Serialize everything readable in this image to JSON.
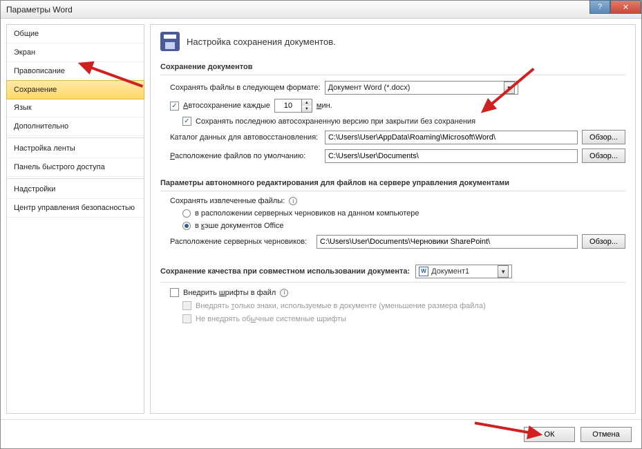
{
  "window": {
    "title": "Параметры Word"
  },
  "sidebar": {
    "items": [
      {
        "label": "Общие"
      },
      {
        "label": "Экран"
      },
      {
        "label": "Правописание"
      },
      {
        "label": "Сохранение",
        "selected": true
      },
      {
        "label": "Язык"
      },
      {
        "label": "Дополнительно"
      },
      {
        "label": "Настройка ленты"
      },
      {
        "label": "Панель быстрого доступа"
      },
      {
        "label": "Надстройки"
      },
      {
        "label": "Центр управления безопасностью"
      }
    ]
  },
  "header": {
    "title": "Настройка сохранения документов."
  },
  "section1": {
    "title": "Сохранение документов",
    "save_format_label": "Сохранять файлы в следующем формате:",
    "save_format_value": "Документ Word (*.docx)",
    "autosave_label_pre": "Автосохранение каждые",
    "autosave_value": "10",
    "autosave_label_post": "мин.",
    "keep_last_label": "Сохранять последнюю автосохраненную версию при закрытии без сохранения",
    "autorecover_label": "Каталог данных для автовосстановления:",
    "autorecover_path": "C:\\Users\\User\\AppData\\Roaming\\Microsoft\\Word\\",
    "default_loc_label": "Расположение файлов по умолчанию:",
    "default_loc_path": "C:\\Users\\User\\Documents\\",
    "browse": "Обзор..."
  },
  "section2": {
    "title": "Параметры автономного редактирования для файлов на сервере управления документами",
    "save_checked_label": "Сохранять извлеченные файлы:",
    "radio1": "в расположении серверных черновиков на данном компьютере",
    "radio2": "в кэше документов Office",
    "drafts_label": "Расположение серверных черновиков:",
    "drafts_path": "C:\\Users\\User\\Documents\\Черновики SharePoint\\",
    "browse": "Обзор..."
  },
  "section3": {
    "title": "Сохранение качества при совместном использовании документа:",
    "doc_name": "Документ1",
    "embed_fonts": "Внедрить шрифты в файл",
    "embed_only_used": "Внедрять только знаки, используемые в документе (уменьшение размера файла)",
    "no_system_fonts": "Не внедрять обычные системные шрифты"
  },
  "footer": {
    "ok": "ОК",
    "cancel": "Отмена"
  }
}
